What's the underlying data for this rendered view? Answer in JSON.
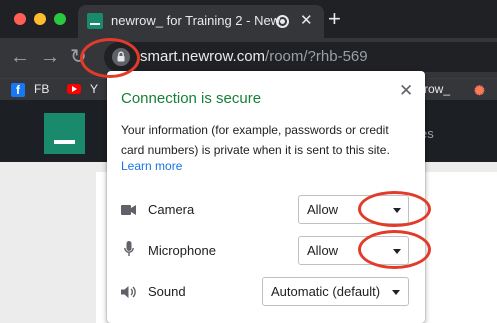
{
  "tab": {
    "title": "newrow_ for Training 2 - New"
  },
  "toolbar": {
    "url_host": "smart.newrow.com",
    "url_path": "/room/?rhb-569"
  },
  "bookmarks": [
    {
      "label": "FB"
    },
    {
      "label": "Y"
    },
    {
      "label": "row_"
    }
  ],
  "page": {
    "header_text": "es"
  },
  "popup": {
    "title": "Connection is secure",
    "description": "Your information (for example, passwords or credit card numbers) is private when it is sent to this site.",
    "learn_more": "Learn more",
    "permissions": [
      {
        "label": "Camera",
        "icon": "camera-icon",
        "value": "Allow"
      },
      {
        "label": "Microphone",
        "icon": "microphone-icon",
        "value": "Allow"
      },
      {
        "label": "Sound",
        "icon": "speaker-icon",
        "value": "Automatic (default)"
      }
    ]
  },
  "colors": {
    "secure_green": "#188038",
    "link_blue": "#1a73e8",
    "annotation_red": "#e23b2a",
    "brand_green": "#1a8a6c"
  }
}
